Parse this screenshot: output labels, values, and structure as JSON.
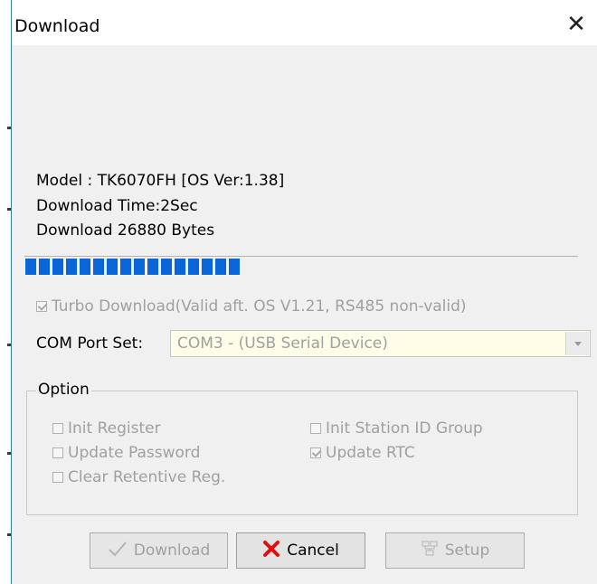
{
  "window": {
    "title": "Download",
    "close_glyph": "✕"
  },
  "info": {
    "model": "Model : TK6070FH  [OS Ver:1.38]",
    "download_time": "Download Time:2Sec",
    "download_bytes": "Download 26880 Bytes"
  },
  "progress": {
    "filled_segments": 16,
    "fraction_filled": 0.39
  },
  "turbo_download": {
    "label": "Turbo Download(Valid aft. OS V1.21, RS485 non-valid)",
    "checked": true,
    "enabled": false
  },
  "com_port": {
    "label": "COM Port Set:",
    "selected": "COM3 - (USB Serial Device)"
  },
  "option_group": {
    "legend": "Option",
    "init_register": "Init Register",
    "update_password": "Update Password",
    "clear_retentive": "Clear Retentive Reg.",
    "init_station_id": "Init Station ID Group",
    "update_rtc": "Update RTC"
  },
  "buttons": {
    "download": "Download",
    "cancel": "Cancel",
    "setup": "Setup"
  },
  "icons": {
    "download": "checkmark-icon",
    "cancel": "red-x-icon",
    "setup": "network-icon"
  },
  "colors": {
    "progress": "#0a66d8",
    "cancel_icon": "#e01010",
    "combo_background": "#fdfde8"
  }
}
